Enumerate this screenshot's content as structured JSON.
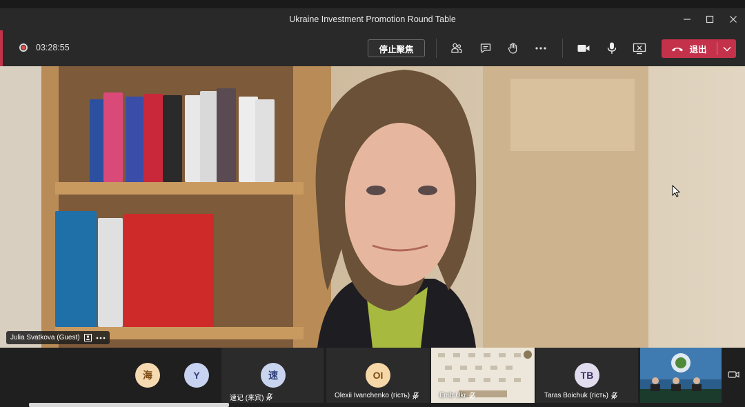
{
  "window": {
    "title": "Ukraine Investment Promotion Round Table",
    "controls": [
      "minimize",
      "maximize",
      "close"
    ]
  },
  "toolbar": {
    "timer": "03:28:55",
    "stop_spotlight_label": "停止聚焦",
    "leave_label": "退出",
    "icons": [
      "participants-icon",
      "chat-icon",
      "raise-hand-icon",
      "more-icon",
      "camera-icon",
      "mic-icon",
      "share-screen-icon"
    ]
  },
  "main_video": {
    "participant_name": "Julia Svatkova (Guest)"
  },
  "participants": [
    {
      "initial": "海",
      "name": "",
      "avatar_color": "#f5d9b0",
      "text_color": "#7a4a14"
    },
    {
      "initial": "Y",
      "name": "",
      "avatar_color": "#c7d3f0",
      "text_color": "#2e3f7a"
    },
    {
      "initial": "速",
      "name": "速记 (来宾)",
      "avatar_color": "#c9d4ee",
      "text_color": "#2e3f7a"
    },
    {
      "initial": "OI",
      "name": "Olexii Ivanchenko (гість)",
      "avatar_color": "#f6d7a8",
      "text_color": "#7a4a14"
    },
    {
      "initial": "",
      "name": "Emb Ukr",
      "avatar_color": "",
      "text_color": ""
    },
    {
      "initial": "TB",
      "name": "Taras Boichuk (гість)",
      "avatar_color": "#e2dcef",
      "text_color": "#3b2f63"
    },
    {
      "initial": "",
      "name": "",
      "avatar_color": "",
      "text_color": ""
    }
  ],
  "colors": {
    "leave_red": "#c4314b",
    "bar_bg": "#292929",
    "record_red": "#e34b4b"
  }
}
